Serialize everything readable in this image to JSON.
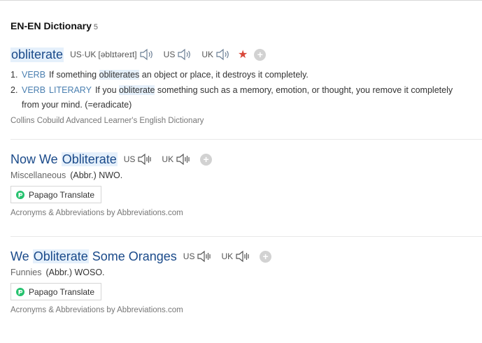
{
  "header": {
    "title": "EN-EN Dictionary",
    "count": "5"
  },
  "entries": [
    {
      "headword": "obliterate",
      "pron_label": "US·UK",
      "pron_ipa": "[əblɪtəreɪt]",
      "us_label": "US",
      "uk_label": "UK",
      "senses": [
        {
          "num": "1.",
          "pos": "VERB",
          "pre": "If something ",
          "hl": "obliterates",
          "post": " an object or place, it destroys it completely."
        },
        {
          "num": "2.",
          "pos": "VERB",
          "sub": "LITERARY",
          "pre": "If you ",
          "hl": "obliterate",
          "post": " something such as a memory, emotion, or thought, you remove it completely from your mind. (=eradicate)"
        }
      ],
      "source": "Collins Cobuild Advanced Learner's English Dictionary"
    },
    {
      "headword_pre": "Now We ",
      "headword_hl": "Obliterate",
      "headword_post": "",
      "us_label": "US",
      "uk_label": "UK",
      "category": "Miscellaneous",
      "meaning": "(Abbr.) NWO.",
      "papago_label": "Papago Translate",
      "source": "Acronyms & Abbreviations by Abbreviations.com"
    },
    {
      "headword_pre": "We ",
      "headword_hl": "Obliterate",
      "headword_post": " Some Oranges",
      "us_label": "US",
      "uk_label": "UK",
      "category": "Funnies",
      "meaning": "(Abbr.) WOSO.",
      "papago_label": "Papago Translate",
      "source": "Acronyms & Abbreviations by Abbreviations.com"
    }
  ],
  "icons": {
    "speaker": "speaker-icon",
    "star": "star-icon",
    "add": "plus-icon",
    "papago": "papago-icon"
  },
  "colors": {
    "link": "#1a4a8a",
    "highlight": "#e5f0fb",
    "star": "#d8473a",
    "pos": "#4a7fb0"
  }
}
